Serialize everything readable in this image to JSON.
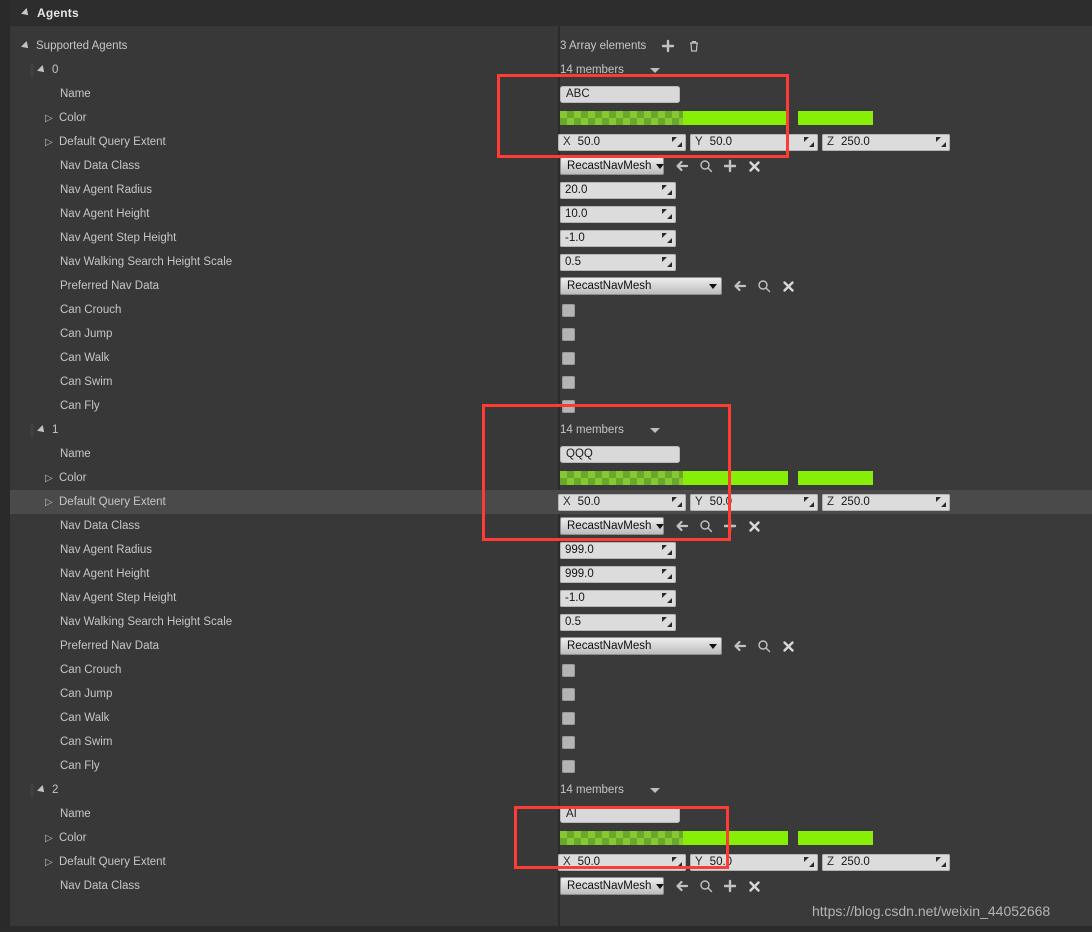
{
  "panel": {
    "category_title": "Agents",
    "root_property": "Supported Agents",
    "array_count_label": "3 Array elements",
    "add_icon": "plus-icon",
    "delete_icon": "trash-icon"
  },
  "labels": {
    "name": "Name",
    "color": "Color",
    "default_query_extent": "Default Query Extent",
    "nav_data_class": "Nav Data Class",
    "nav_agent_radius": "Nav Agent Radius",
    "nav_agent_height": "Nav Agent Height",
    "nav_agent_step_height": "Nav Agent Step Height",
    "nav_walking_search_height_scale": "Nav Walking Search Height Scale",
    "preferred_nav_data": "Preferred Nav Data",
    "can_crouch": "Can Crouch",
    "can_jump": "Can Jump",
    "can_walk": "Can Walk",
    "can_swim": "Can Swim",
    "can_fly": "Can Fly"
  },
  "members_label": "14 members",
  "axis": {
    "x": "X",
    "y": "Y",
    "z": "Z"
  },
  "agents": [
    {
      "index": "0",
      "members": "14 members",
      "name": "ABC",
      "color_swatch": {
        "checker": "#87c832",
        "solid": "#86ee07"
      },
      "query_extent": {
        "x": "50.0",
        "y": "50.0",
        "z": "250.0"
      },
      "nav_data_class": "RecastNavMesh",
      "nav_agent_radius": "20.0",
      "nav_agent_height": "10.0",
      "nav_agent_step_height": "-1.0",
      "nav_walking_search_height_scale": "0.5",
      "preferred_nav_data": "RecastNavMesh",
      "can_crouch": false,
      "can_jump": false,
      "can_walk": false,
      "can_swim": false,
      "can_fly": false
    },
    {
      "index": "1",
      "members": "14 members",
      "name": "QQQ",
      "color_swatch": {
        "checker": "#87c832",
        "solid": "#86ee07"
      },
      "query_extent": {
        "x": "50.0",
        "y": "50.0",
        "z": "250.0"
      },
      "nav_data_class": "RecastNavMesh",
      "nav_agent_radius": "999.0",
      "nav_agent_height": "999.0",
      "nav_agent_step_height": "-1.0",
      "nav_walking_search_height_scale": "0.5",
      "preferred_nav_data": "RecastNavMesh",
      "can_crouch": false,
      "can_jump": false,
      "can_walk": false,
      "can_swim": false,
      "can_fly": false
    },
    {
      "index": "2",
      "members": "14 members",
      "name": "AI",
      "color_swatch": {
        "checker": "#87c832",
        "solid": "#86ee07"
      },
      "query_extent": {
        "x": "50.0",
        "y": "50.0",
        "z": "250.0"
      },
      "nav_data_class": "RecastNavMesh"
    }
  ],
  "class_picker_icons": [
    "back-arrow-icon",
    "browse-icon",
    "use-selected-icon",
    "clear-icon"
  ],
  "watermark": "https://blog.csdn.net/weixin_44052668",
  "colors": {
    "panel_bg": "#383838",
    "header_bg": "#2d2d2d",
    "selected_row": "#4a4a4a",
    "annotation": "#ff3b36",
    "field_bg": "#dcdcdc"
  }
}
